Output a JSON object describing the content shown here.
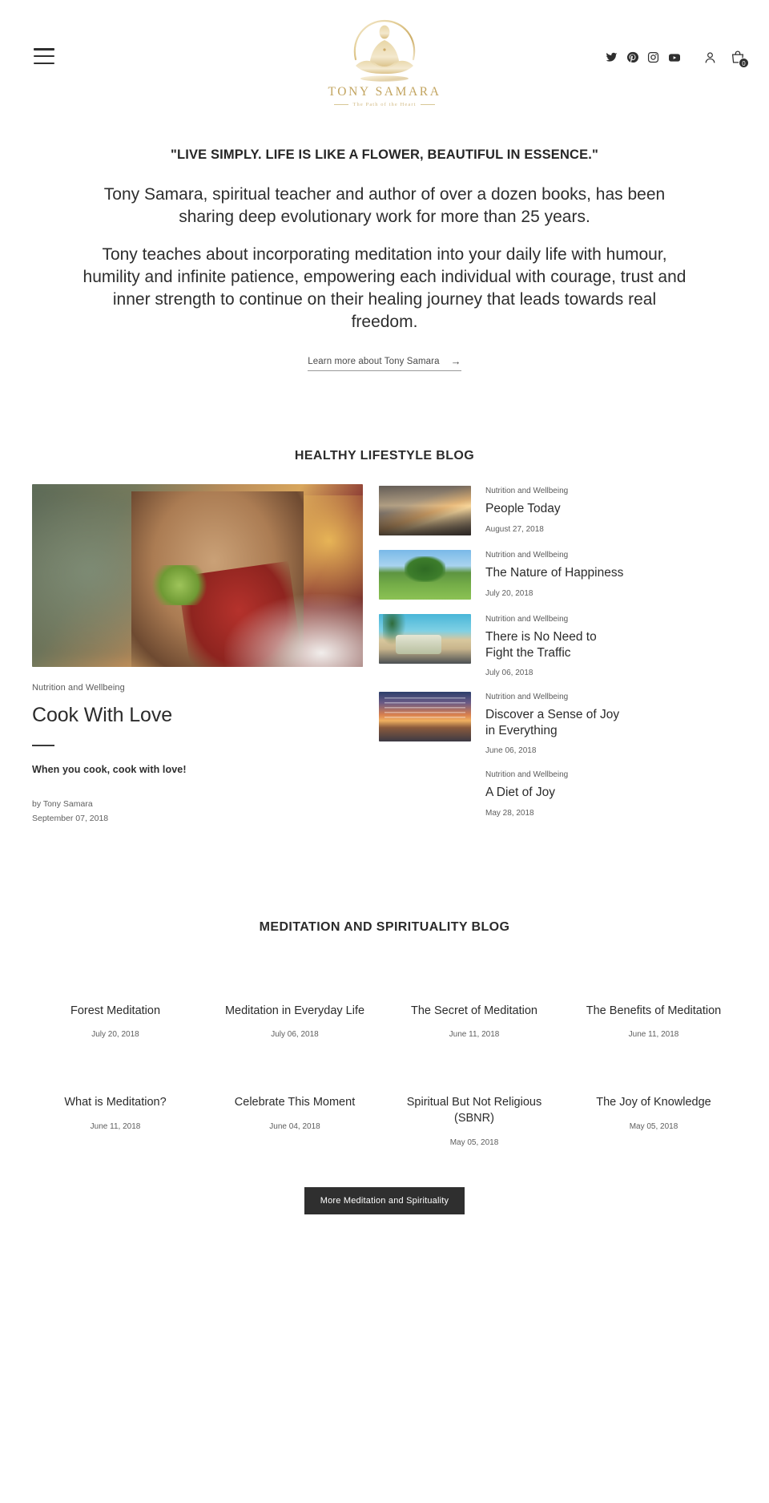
{
  "header": {
    "menu_label": "Menu",
    "logo": {
      "title": "TONY SAMARA",
      "tagline": "The Path of the Heart"
    },
    "social": [
      {
        "name": "twitter-icon",
        "label": "Twitter"
      },
      {
        "name": "pinterest-icon",
        "label": "Pinterest"
      },
      {
        "name": "instagram-icon",
        "label": "Instagram"
      },
      {
        "name": "youtube-icon",
        "label": "YouTube"
      }
    ],
    "account_label": "Account",
    "cart_label": "Cart",
    "cart_count": "0"
  },
  "hero": {
    "quote": "\"LIVE SIMPLY. LIFE IS LIKE A FLOWER, BEAUTIFUL IN ESSENCE.\"",
    "paragraph_1": "Tony Samara, spiritual teacher and author of over a dozen books, has been sharing deep evolutionary work for more than 25 years.",
    "paragraph_2": "Tony teaches about incorporating meditation into your daily life with humour, humility and infinite patience, empowering each individual with courage, trust and inner strength to continue on their healing journey that leads towards real freedom.",
    "link_label": "Learn more about Tony Samara",
    "link_arrow": "→"
  },
  "lifestyle": {
    "title": "HEALTHY LIFESTYLE BLOG",
    "feature": {
      "category": "Nutrition and Wellbeing",
      "title": "Cook With Love",
      "excerpt": "When you cook, cook with love!",
      "author": "by Tony Samara",
      "date": "September 07, 2018"
    },
    "side_items": [
      {
        "category": "Nutrition and Wellbeing",
        "title": "People Today",
        "date": "August 27, 2018",
        "thumb": "t-city"
      },
      {
        "category": "Nutrition and Wellbeing",
        "title": "The Nature of Happiness",
        "date": "July 20, 2018",
        "thumb": "t-tree"
      },
      {
        "category": "Nutrition and Wellbeing",
        "title": "There is No Need to Fight the Traffic",
        "date": "July 06, 2018",
        "thumb": "t-van"
      },
      {
        "category": "Nutrition and Wellbeing",
        "title": "Discover a Sense of Joy in Everything",
        "date": "June 06, 2018",
        "thumb": "t-sunset"
      },
      {
        "category": "Nutrition and Wellbeing",
        "title": "A Diet of Joy",
        "date": "May 28, 2018",
        "thumb": ""
      }
    ]
  },
  "meditation": {
    "title": "MEDITATION AND SPIRITUALITY BLOG",
    "cards": [
      {
        "title": "Forest Meditation",
        "date": "July 20, 2018"
      },
      {
        "title": "Meditation in Everyday Life",
        "date": "July 06, 2018"
      },
      {
        "title": "The Secret of Meditation",
        "date": "June 11, 2018"
      },
      {
        "title": "The Benefits of Meditation",
        "date": "June 11, 2018"
      },
      {
        "title": "What is Meditation?",
        "date": "June 11, 2018"
      },
      {
        "title": "Celebrate This Moment",
        "date": "June 04, 2018"
      },
      {
        "title": "Spiritual But Not Religious (SBNR)",
        "date": "May 05, 2018"
      },
      {
        "title": "The Joy of Knowledge",
        "date": "May 05, 2018"
      }
    ],
    "cta_label": "More Meditation and Spirituality"
  },
  "colors": {
    "gold": "#c2a45f",
    "text": "#2b2b2b",
    "muted": "#5e5e5e",
    "cta_bg": "#2f2f2f"
  }
}
